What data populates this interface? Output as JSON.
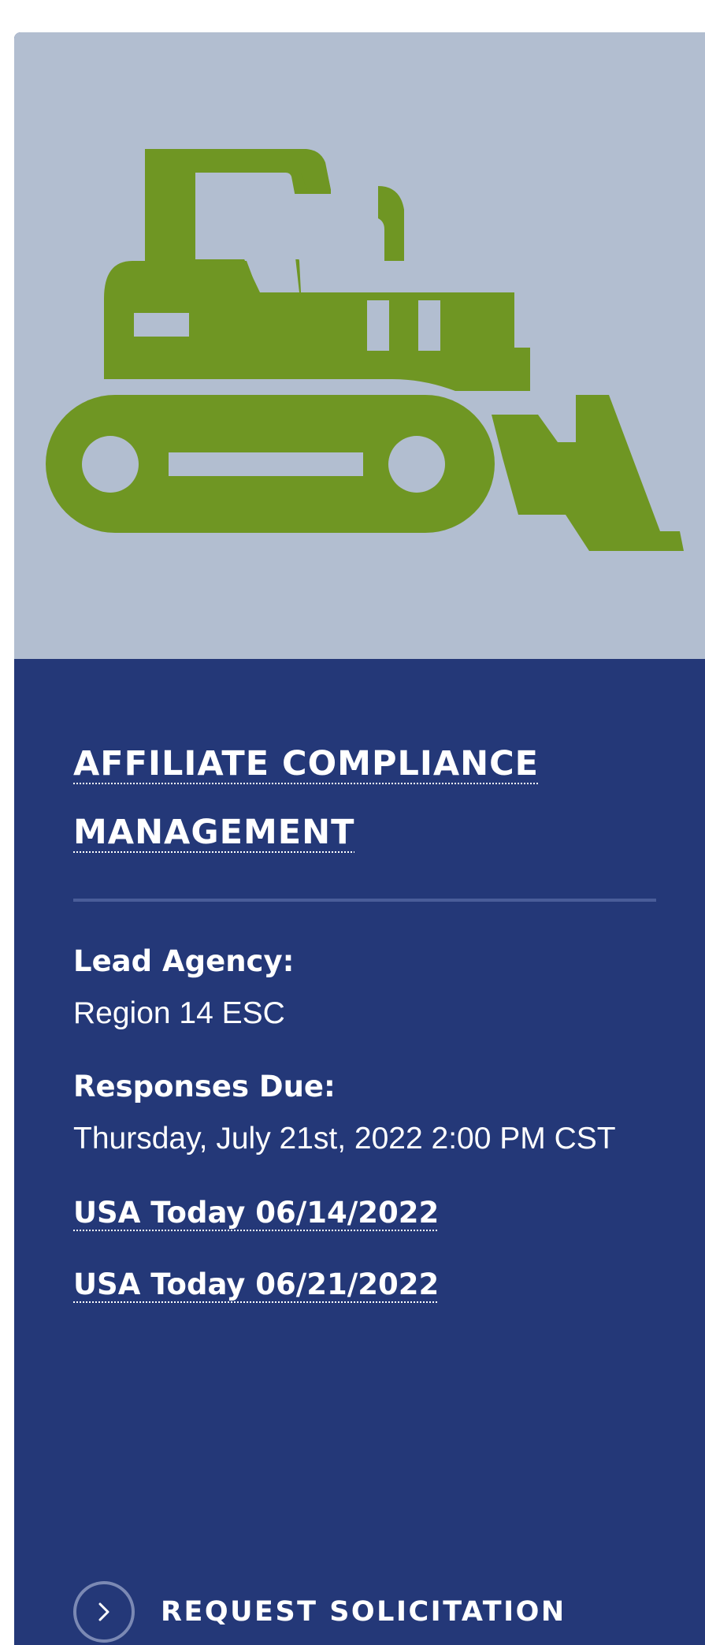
{
  "card": {
    "hero_icon": "bulldozer-icon",
    "colors": {
      "hero_background": "#b2bed0",
      "icon": "#6f9623",
      "panel": "#243878",
      "divider": "#4a5d99",
      "text": "#ffffff"
    },
    "title_line1": "AFFILIATE COMPLIANCE",
    "title_line2": "MANAGEMENT",
    "lead_agency_label": "Lead Agency:",
    "lead_agency_value": "Region 14 ESC",
    "responses_due_label": "Responses Due:",
    "responses_due_value": "Thursday, July 21st, 2022 2:00 PM CST",
    "links": [
      {
        "label": "USA Today 06/14/2022"
      },
      {
        "label": "USA Today 06/21/2022"
      }
    ],
    "cta": {
      "icon": "chevron-right-icon",
      "label": "REQUEST SOLICITATION"
    }
  }
}
